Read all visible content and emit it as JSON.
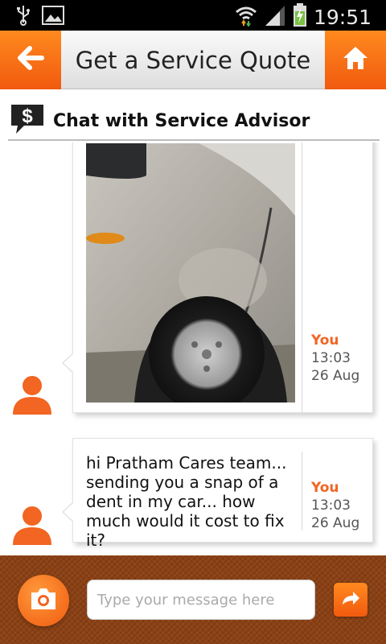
{
  "status_bar": {
    "time": "19:51",
    "icons": [
      "usb-icon",
      "image-icon",
      "wifi-icon",
      "signal-icon",
      "battery-charging-icon"
    ]
  },
  "app_bar": {
    "title": "Get a Service Quote",
    "back_icon": "arrow-left-icon",
    "home_icon": "home-icon"
  },
  "section": {
    "title": "Chat with Service Advisor",
    "icon": "dollar-chat-icon"
  },
  "messages": [
    {
      "type": "image",
      "image_description": "photo-of-car-dent",
      "sender": "You",
      "time": "13:03",
      "date": "26 Aug"
    },
    {
      "type": "text",
      "text": "hi Pratham Cares team... sending you a snap of a dent in my car... how much would it cost to fix it?",
      "sender": "You",
      "time": "13:03",
      "date": "26 Aug"
    }
  ],
  "composer": {
    "placeholder": "Type your message here",
    "value": "",
    "camera_icon": "camera-icon",
    "send_icon": "share-arrow-icon"
  },
  "colors": {
    "accent": "#f26522",
    "bottom_bar": "#8a3f12"
  }
}
